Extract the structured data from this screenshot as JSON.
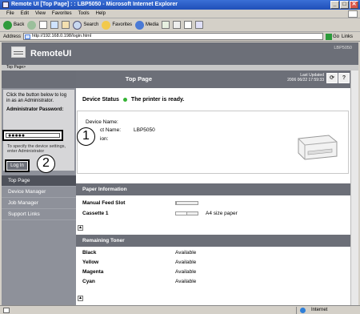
{
  "window": {
    "title": "Remote UI [Top Page] : : LBP5050 - Microsoft Internet Explorer",
    "minimize": "_",
    "maximize": "□",
    "close": "✕"
  },
  "menu": [
    "File",
    "Edit",
    "View",
    "Favorites",
    "Tools",
    "Help"
  ],
  "toolbar": {
    "back": "Back",
    "search": "Search",
    "favorites": "Favorites",
    "media": "Media"
  },
  "address": {
    "label": "Address",
    "url": "http://192.168.0.198/login.html",
    "go": "Go",
    "links": "Links"
  },
  "header": {
    "brand": "RemoteUI",
    "model": "LBP5050"
  },
  "breadcrumb": "Top Page>",
  "sidebar": {
    "login_text": "Click the button below to log in as an Administrator.",
    "password_label": "Administrator Password:",
    "password_value": "●●●●●",
    "desc": "To specify the device settings, enter Administrator",
    "login_button": "Log In",
    "nav": [
      "Top Page",
      "Device Manager",
      "Job Manager",
      "Support Links"
    ]
  },
  "main": {
    "title": "Top Page",
    "last_updated_label": "Last Updated",
    "last_updated_value": "2006 06/22 17:59:33",
    "refresh_icon": "⟳",
    "help_icon": "?",
    "status_label": "Device Status",
    "status_text": "The printer is ready.",
    "device_name_label": "Device Name:",
    "product_name_label": "ct Name:",
    "product_name_value": "LBP5050",
    "location_label": "ion:",
    "paper_section": "Paper Information",
    "paper_rows": [
      {
        "name": "Manual Feed Slot",
        "level": 0,
        "value": ""
      },
      {
        "name": "Cassette 1",
        "level": 0.5,
        "value": "A4 size paper"
      }
    ],
    "toner_section": "Remaining Toner",
    "toner_rows": [
      {
        "name": "Black",
        "value": "Available"
      },
      {
        "name": "Yellow",
        "value": "Available"
      },
      {
        "name": "Magenta",
        "value": "Available"
      },
      {
        "name": "Cyan",
        "value": "Available"
      }
    ],
    "arrow_up": "▲"
  },
  "callouts": {
    "one": "1",
    "two": "2"
  },
  "statusbar": {
    "zone": "Internet"
  }
}
